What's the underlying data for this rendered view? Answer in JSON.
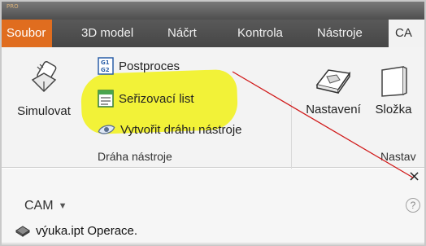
{
  "app": {
    "edition_label": "PRO"
  },
  "tabs": [
    {
      "label": "Soubor"
    },
    {
      "label": "3D model"
    },
    {
      "label": "Náčrt"
    },
    {
      "label": "Kontrola"
    },
    {
      "label": "Nástroje"
    },
    {
      "label": "CA"
    }
  ],
  "ribbon": {
    "toolpath_group": {
      "title": "Dráha nástroje",
      "simulate_label": "Simulovat",
      "postprocess_label": "Postproces",
      "setup_sheet_label": "Seřizovací list",
      "create_toolpath_label": "Vytvořit dráhu nástroje"
    },
    "setup_group": {
      "title_partial": "Nastav",
      "setup_label": "Nastavení",
      "folder_label": "Složka"
    }
  },
  "panel": {
    "title": "CAM",
    "close_glyph": "×",
    "help_glyph": "?",
    "tree_item_label": "výuka.ipt Operace."
  },
  "colors": {
    "file_tab": "#e06d1f",
    "highlight": "#f2f228",
    "annotation_line": "#d01818",
    "ribbon_bg": "#f3f3f3",
    "tab_bg": "#4f4f4f"
  },
  "icons": {
    "simulate": "mill-tool-icon",
    "postprocess": "g-code-icon",
    "setup_sheet": "sheet-icon",
    "create_toolpath": "eye-icon",
    "setup": "setup-icon",
    "folder": "folder-icon",
    "tree_item": "part-icon"
  }
}
